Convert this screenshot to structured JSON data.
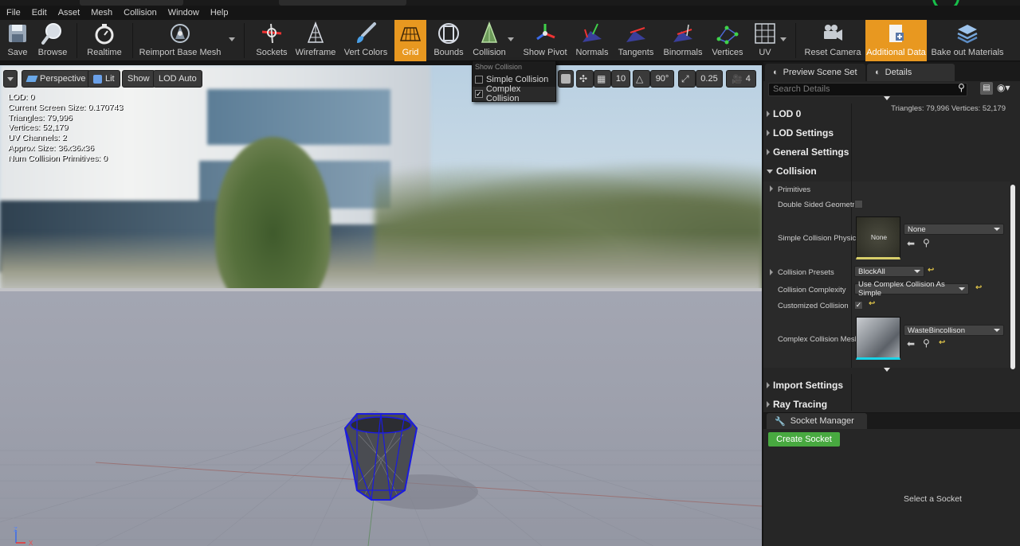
{
  "menu": [
    "File",
    "Edit",
    "Asset",
    "Mesh",
    "Collision",
    "Window",
    "Help"
  ],
  "toolbar": {
    "save": "Save",
    "browse": "Browse",
    "realtime": "Realtime",
    "reimport": "Reimport Base Mesh",
    "sockets": "Sockets",
    "wireframe": "Wireframe",
    "vert_colors": "Vert Colors",
    "grid": "Grid",
    "bounds": "Bounds",
    "collision": "Collision",
    "show_pivot": "Show Pivot",
    "normals": "Normals",
    "tangents": "Tangents",
    "binormals": "Binormals",
    "vertices": "Vertices",
    "uv": "UV",
    "reset_camera": "Reset Camera",
    "additional_data": "Additional Data",
    "bake_out": "Bake out Materials",
    "accent": "#e89820"
  },
  "collision_menu": {
    "header": "Show Collision",
    "simple": "Simple Collision",
    "complex": "Complex Collision",
    "complex_checked": true
  },
  "viewport": {
    "perspective": "Perspective",
    "lit": "Lit",
    "show": "Show",
    "lod_auto": "LOD Auto",
    "grid_snap": "10",
    "rot_snap": "90°",
    "scale_snap": "0.25",
    "cam_speed": "4",
    "stats": [
      "LOD:  0",
      "Current Screen Size:  0.170743",
      "Triangles:  79,996",
      "Vertices:  52,179",
      "UV Channels:  2",
      "Approx Size: 36x36x36",
      "Num Collision Primitives:  0"
    ],
    "axis_z": "Z",
    "axis_x": "X"
  },
  "panel": {
    "tab_preview": "Preview Scene Set",
    "tab_details": "Details",
    "search_placeholder": "Search Details",
    "tri_count": "Triangles: 79,996   Vertices: 52,179",
    "categories": {
      "lod0": "LOD 0",
      "lod_settings": "LOD Settings",
      "general": "General Settings",
      "collision": "Collision",
      "import": "Import Settings",
      "ray": "Ray Tracing"
    },
    "props": {
      "primitives": "Primitives",
      "double_sided": "Double Sided Geometry",
      "simple_phys": "Simple Collision Physica",
      "simple_phys_thumb": "None",
      "simple_phys_value": "None",
      "presets": "Collision Presets",
      "presets_value": "BlockAll",
      "complexity": "Collision Complexity",
      "complexity_value": "Use Complex Collision As Simple",
      "customized": "Customized Collision",
      "complex_mesh": "Complex Collision Mesh",
      "complex_mesh_value": "WasteBincollison"
    }
  },
  "socket": {
    "tab": "Socket Manager",
    "create": "Create Socket",
    "empty": "Select a Socket"
  }
}
